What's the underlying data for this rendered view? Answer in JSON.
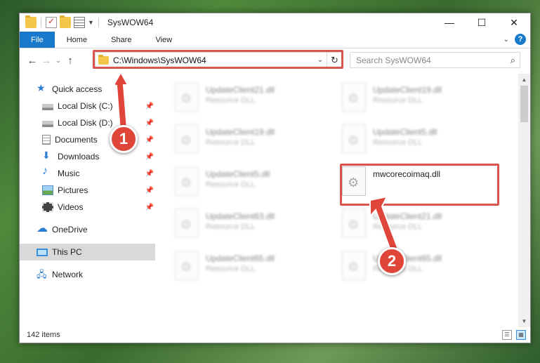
{
  "window": {
    "title": "SysWOW64"
  },
  "ribbon": {
    "tabs": [
      "File",
      "Home",
      "Share",
      "View"
    ]
  },
  "address": {
    "path": "C:\\Windows\\SysWOW64",
    "search_placeholder": "Search SysWOW64"
  },
  "nav": {
    "items": [
      {
        "label": "Quick access",
        "icon": "star-icon"
      },
      {
        "label": "Local Disk (C:)",
        "icon": "disk-icon",
        "pinned": true
      },
      {
        "label": "Local Disk (D:)",
        "icon": "disk-icon",
        "pinned": true
      },
      {
        "label": "Documents",
        "icon": "documents-icon",
        "pinned": true
      },
      {
        "label": "Downloads",
        "icon": "downloads-icon",
        "pinned": true
      },
      {
        "label": "Music",
        "icon": "music-icon",
        "pinned": true
      },
      {
        "label": "Pictures",
        "icon": "pictures-icon",
        "pinned": true
      },
      {
        "label": "Videos",
        "icon": "videos-icon",
        "pinned": true
      },
      {
        "label": "OneDrive",
        "icon": "onedrive-icon"
      },
      {
        "label": "This PC",
        "icon": "this-pc-icon",
        "selected": true
      },
      {
        "label": "Network",
        "icon": "network-icon"
      }
    ]
  },
  "files": {
    "col1": [
      {
        "name": "UpdateClient21.dll",
        "type": "Resource DLL"
      },
      {
        "name": "UpdateClient19.dll",
        "type": "Resource DLL"
      },
      {
        "name": "UpdateClient5.dll",
        "type": "Resource DLL"
      },
      {
        "name": "UpdateClient63.dll",
        "type": "Resource DLL"
      },
      {
        "name": "UpdateClient65.dll",
        "type": "Resource DLL"
      }
    ],
    "col2": [
      {
        "name": "UpdateClient19.dll",
        "type": "Resource DLL"
      },
      {
        "name": "UpdateClient5.dll",
        "type": "Resource DLL"
      },
      {
        "name": "mwcorecoimaq.dll",
        "type": ""
      },
      {
        "name": "UpdateClient21.dll",
        "type": "Resource DLL"
      },
      {
        "name": "UpdateClient65.dll",
        "type": "Resource DLL"
      }
    ]
  },
  "status": {
    "count": "142 items"
  },
  "annotations": {
    "step1": "1",
    "step2": "2",
    "color": "#e0453a"
  }
}
